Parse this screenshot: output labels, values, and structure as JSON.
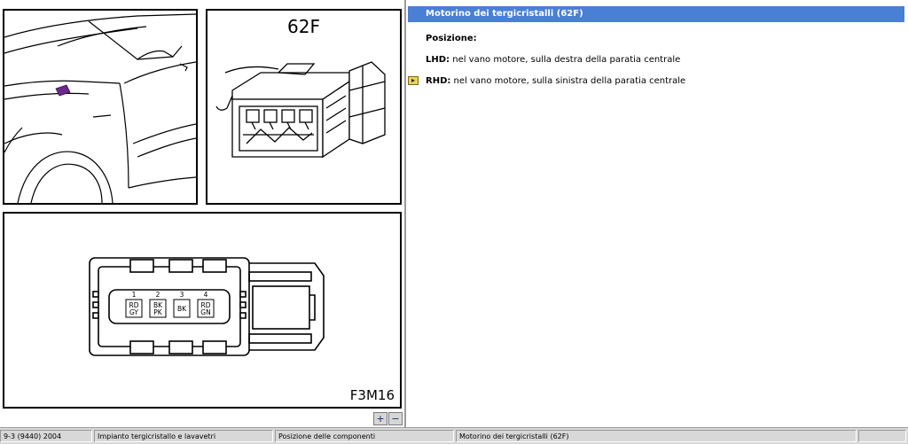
{
  "diagram": {
    "connector_title": "62F",
    "figure_code": "F3M16",
    "pins": [
      {
        "number": "1",
        "color_top": "RD",
        "color_bottom": "GY"
      },
      {
        "number": "2",
        "color_top": "BK",
        "color_bottom": "PK"
      },
      {
        "number": "3",
        "color_top": "BK",
        "color_bottom": ""
      },
      {
        "number": "4",
        "color_top": "RD",
        "color_bottom": "GN"
      }
    ],
    "zoom_in_label": "+",
    "zoom_out_label": "−"
  },
  "info": {
    "title": "Motorino dei tergicristalli (62F)",
    "position_heading": "Posizione:",
    "lhd_label": "LHD:",
    "lhd_text": " nel vano motore, sulla destra della paratia centrale",
    "rhd_label": "RHD:",
    "rhd_text": " nel vano motore, sulla sinistra della paratia centrale",
    "accent_color": "#4a7fd6"
  },
  "status_bar": {
    "model": "9-3 (9440) 2004",
    "system": "Impianto tergicristallo e lavavetri",
    "section": "Posizione delle componenti",
    "component": "Motorino dei tergicristalli (62F)"
  }
}
